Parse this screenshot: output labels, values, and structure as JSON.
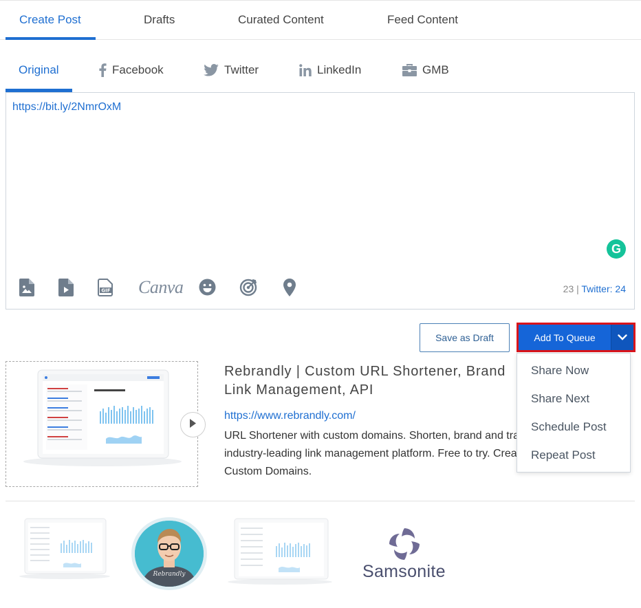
{
  "main_tabs": [
    {
      "label": "Create Post",
      "active": true
    },
    {
      "label": "Drafts",
      "active": false
    },
    {
      "label": "Curated Content",
      "active": false
    },
    {
      "label": "Feed Content",
      "active": false
    }
  ],
  "network_tabs": [
    {
      "label": "Original",
      "icon": null,
      "active": true
    },
    {
      "label": "Facebook",
      "icon": "facebook-icon",
      "active": false
    },
    {
      "label": "Twitter",
      "icon": "twitter-icon",
      "active": false
    },
    {
      "label": "LinkedIn",
      "icon": "linkedin-icon",
      "active": false
    },
    {
      "label": "GMB",
      "icon": "briefcase-icon",
      "active": false
    }
  ],
  "editor": {
    "text": "https://bit.ly/2NmrOxM",
    "grammarly_label": "G",
    "toolbar_icons": [
      "image-icon",
      "video-icon",
      "gif-icon",
      "canva-icon",
      "emoji-icon",
      "target-icon",
      "location-icon"
    ],
    "canva_label": "Canva",
    "char_count": "23",
    "separator": "|",
    "twitter_count": "Twitter: 24"
  },
  "actions": {
    "save_draft_label": "Save as Draft",
    "add_to_queue_label": "Add To Queue",
    "dropdown_items": [
      "Share Now",
      "Share Next",
      "Schedule Post",
      "Repeat Post"
    ]
  },
  "preview": {
    "title": "Rebrandly | Custom URL Shortener, Brand Link Management, API",
    "url": "https://www.rebrandly.com/",
    "description": "URL Shortener with custom domains. Shorten, brand and track URLs with the industry-leading link management platform. Free to try. Create Branded Links with Custom Domains."
  },
  "thumbnails": {
    "avatar_shirt_text": "Rebrandly",
    "brand_logo_text": "Samsonite"
  },
  "colors": {
    "accent": "#1f6fd1",
    "queue_button": "#1565d8",
    "highlight_border": "#d9141b",
    "grammarly": "#15c39a"
  }
}
